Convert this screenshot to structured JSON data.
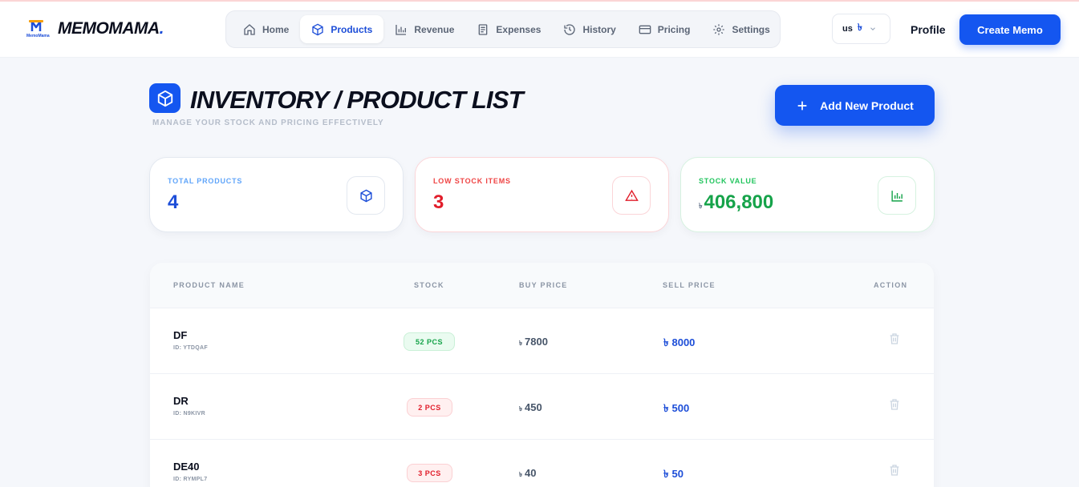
{
  "brand": {
    "name": "MEMOMAMA",
    "dot": ".",
    "mark_text": "MemoMama"
  },
  "nav": [
    {
      "label": "Home",
      "icon": "home-icon",
      "active": false
    },
    {
      "label": "Products",
      "icon": "box-icon",
      "active": true
    },
    {
      "label": "Revenue",
      "icon": "bar-chart-icon",
      "active": false
    },
    {
      "label": "Expenses",
      "icon": "document-icon",
      "active": false
    },
    {
      "label": "History",
      "icon": "history-icon",
      "active": false
    },
    {
      "label": "Pricing",
      "icon": "card-icon",
      "active": false
    },
    {
      "label": "Settings",
      "icon": "gear-icon",
      "active": false
    }
  ],
  "currency": {
    "code": "us",
    "symbol": "৳"
  },
  "profile_label": "Profile",
  "create_label": "Create Memo",
  "page": {
    "title": "INVENTORY / PRODUCT LIST",
    "subtitle": "MANAGE YOUR STOCK AND PRICING EFFECTIVELY",
    "add_label": "Add New Product"
  },
  "stats": {
    "total": {
      "label": "TOTAL PRODUCTS",
      "value": "4",
      "icon": "box-icon",
      "color": "#1d4ed8"
    },
    "low": {
      "label": "LOW STOCK ITEMS",
      "value": "3",
      "icon": "warning-icon",
      "color": "#e11d2a"
    },
    "stock_value": {
      "label": "STOCK VALUE",
      "currency": "৳",
      "value": "406,800",
      "icon": "bar-chart-icon",
      "color": "#16a34a"
    }
  },
  "table": {
    "headers": [
      "PRODUCT NAME",
      "STOCK",
      "BUY PRICE",
      "SELL PRICE",
      "ACTION"
    ],
    "rows": [
      {
        "name": "DF",
        "id": "ID: YTDQAF",
        "stock": "52 PCS",
        "stock_status": "ok",
        "buy": "7800",
        "sell": "8000",
        "currency": "৳"
      },
      {
        "name": "DR",
        "id": "ID: N9KIVR",
        "stock": "2 PCS",
        "stock_status": "low",
        "buy": "450",
        "sell": "500",
        "currency": "৳"
      },
      {
        "name": "DE40",
        "id": "ID: RYMPL7",
        "stock": "3 PCS",
        "stock_status": "low",
        "buy": "40",
        "sell": "50",
        "currency": "৳"
      }
    ]
  }
}
